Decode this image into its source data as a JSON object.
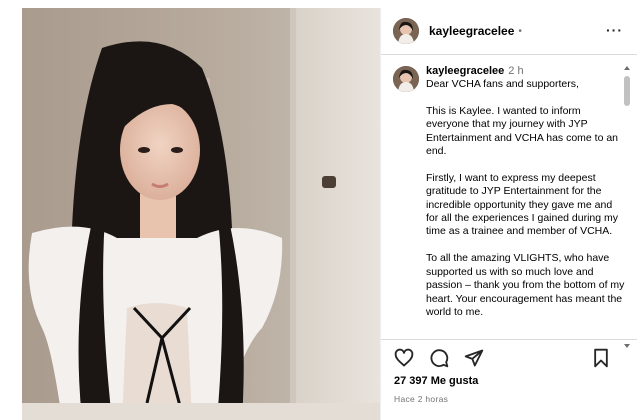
{
  "post": {
    "header_username": "kayleegracelee",
    "header_dot": "•",
    "more_label": "···",
    "caption_username": "kayleegracelee",
    "caption_time": "2 h",
    "caption_text": "Dear VCHA fans and supporters,\n\nThis is Kaylee. I wanted to inform everyone that my journey with JYP Entertainment and VCHA has come to an end.\n\nFirstly, I want to express my deepest gratitude to JYP Entertainment for the incredible opportunity they gave me and for all the experiences I gained during my time as a trainee and member of VCHA.\n\nTo all the amazing VLIGHTS, who have supported us with so much love and passion – thank you from the bottom of my heart. Your encouragement has meant the world to me.",
    "likes": "27 397 Me gusta",
    "timestamp": "Hace 2 horas"
  },
  "icons": {
    "like": "heart-icon",
    "comment": "comment-icon",
    "share": "share-icon",
    "save": "bookmark-icon",
    "more": "more-icon"
  },
  "colors": {
    "text_primary": "#000000",
    "text_secondary": "#737373",
    "border": "#dbdbdb"
  }
}
